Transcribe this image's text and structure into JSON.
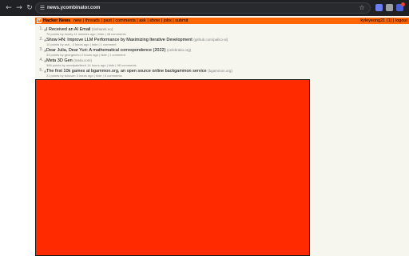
{
  "browser": {
    "url": "news.ycombinator.com",
    "icons": {
      "back": "back-arrow-icon",
      "forward": "forward-arrow-icon",
      "reload": "reload-icon",
      "site_info": "site-info-icon",
      "bookmark": "star-icon"
    }
  },
  "header": {
    "logo_letter": "Y",
    "title": "Hacker News",
    "nav": [
      "new",
      "threads",
      "past",
      "comments",
      "ask",
      "show",
      "jobs",
      "submit"
    ],
    "user": "kyleyeong21 (1)",
    "logout": "logout"
  },
  "stories": [
    {
      "rank": "1.",
      "title": "I Received an AI Email",
      "domain": "(timharek.no)",
      "subtext": "76 points by mosty 11 minutes ago | hide | 48 comments"
    },
    {
      "rank": "2.",
      "title": "Show HN: Improve LLM Performance by Maximizing Iterative Development",
      "domain": "(github.com/palico-ai)",
      "subtext": "10 points by ash_ 3 hours ago | hide | 1 comment"
    },
    {
      "rank": "3.",
      "title": "Dear Julia, Dear Yuri: A mathematical correspondence (2022)",
      "domain": "(celebratio.org)",
      "subtext": "33 points by georgecmu 2 hours ago | hide | 1 comment"
    },
    {
      "rank": "4.",
      "title": "Meta 3D Gen",
      "domain": "(meta.com)",
      "subtext": "386 points by meetpateltech 14 hours ago | hide | 98 comments"
    },
    {
      "rank": "5.",
      "title": "The first 10k games at bgammon.org, an open source online backgammon service",
      "domain": "(bgammon.org)",
      "subtext": "21 points by tslocum 3 hours ago | hide | 6 comments"
    }
  ],
  "colors": {
    "header_orange": "#ff6600",
    "page_bg": "#f6f6ef",
    "panel_red": "#ff2a00"
  }
}
